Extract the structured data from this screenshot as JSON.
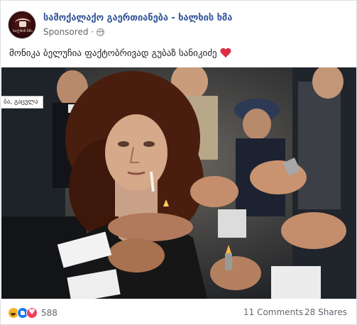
{
  "post": {
    "page_name": "სამოქალაქო გაერთიანება - ხალხის ხმა",
    "avatar_text": "ხალხის ხმა",
    "sponsored_label": "Sponsored",
    "meta_separator": "·",
    "text": "მონიკა ბელუჩია ფაქტობრივად გუბაზ სანიკიძე",
    "image_side_label": "ბა, გაცვლა"
  },
  "footer": {
    "reactions": [
      "haha-icon",
      "like-icon",
      "love-icon"
    ],
    "reaction_count": "588",
    "comments": "11 Comments",
    "shares": "28 Shares"
  },
  "colors": {
    "page_name": "#365899",
    "meta": "#616770",
    "like": "#1877f2",
    "love": "#f33e58",
    "haha": "#f7b125"
  }
}
